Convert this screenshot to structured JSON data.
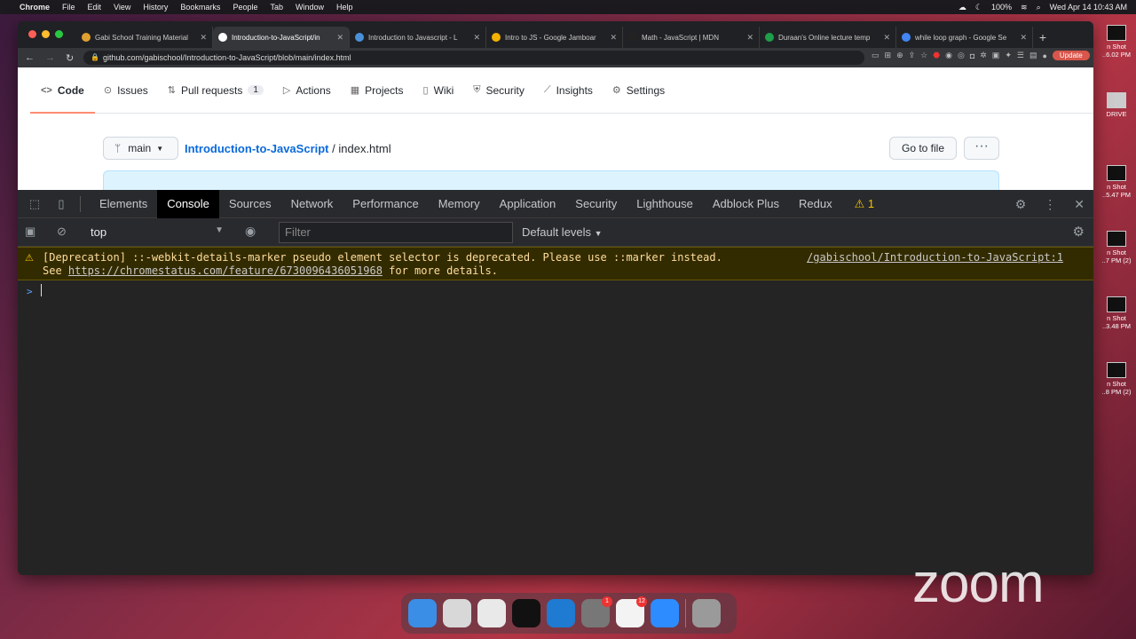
{
  "menubar": {
    "items": [
      "Chrome",
      "File",
      "Edit",
      "View",
      "History",
      "Bookmarks",
      "People",
      "Tab",
      "Window",
      "Help"
    ],
    "battery": "100%",
    "clock": "Wed Apr 14  10:43 AM"
  },
  "desktop": {
    "items": [
      {
        "label": "n Shot",
        "sub": "..6.02 PM"
      },
      {
        "label": "DRIVE",
        "sub": ""
      },
      {
        "label": "n Shot",
        "sub": "..5.47 PM"
      },
      {
        "label": "n Shot",
        "sub": "..7 PM (2)"
      },
      {
        "label": "n Shot",
        "sub": "..3.48 PM"
      },
      {
        "label": "n Shot",
        "sub": "..8 PM (2)"
      }
    ]
  },
  "browser": {
    "tabs": [
      {
        "title": "Gabi School Training Material",
        "icon_color": "#e0a030"
      },
      {
        "title": "Introduction-to-JavaScript/in",
        "icon_color": "#ffffff"
      },
      {
        "title": "Introduction to Javascript - L",
        "icon_color": "#4a90d9"
      },
      {
        "title": "Intro to JS - Google Jamboar",
        "icon_color": "#f2b200"
      },
      {
        "title": "Math - JavaScript | MDN",
        "icon_color": "#222222"
      },
      {
        "title": "Duraan's Online lecture temp",
        "icon_color": "#1e9e4a"
      },
      {
        "title": "while loop graph - Google Se",
        "icon_color": "#4285f4"
      }
    ],
    "url": "github.com/gabischool/Introduction-to-JavaScript/blob/main/index.html",
    "update_label": "Update"
  },
  "github": {
    "nav": [
      {
        "label": "Code",
        "icon": "<>",
        "count": ""
      },
      {
        "label": "Issues",
        "icon": "⊙",
        "count": ""
      },
      {
        "label": "Pull requests",
        "icon": "⇅",
        "count": "1"
      },
      {
        "label": "Actions",
        "icon": "▷",
        "count": ""
      },
      {
        "label": "Projects",
        "icon": "▦",
        "count": ""
      },
      {
        "label": "Wiki",
        "icon": "▯",
        "count": ""
      },
      {
        "label": "Security",
        "icon": "⛨",
        "count": ""
      },
      {
        "label": "Insights",
        "icon": "⟋",
        "count": ""
      },
      {
        "label": "Settings",
        "icon": "⚙",
        "count": ""
      }
    ],
    "branch": "main",
    "repo": "Introduction-to-JavaScript",
    "sep": " / ",
    "file": "index.html",
    "goto_file": "Go to file",
    "more": "···"
  },
  "devtools": {
    "tabs": [
      "Elements",
      "Console",
      "Sources",
      "Network",
      "Performance",
      "Memory",
      "Application",
      "Security",
      "Lighthouse",
      "Adblock Plus",
      "Redux"
    ],
    "active_tab": "Console",
    "warning_count": "1",
    "context": "top",
    "filter_placeholder": "Filter",
    "levels": "Default levels"
  },
  "console": {
    "message_line1": "[Deprecation] ::-webkit-details-marker pseudo element selector is deprecated. Please use ::marker instead.",
    "message_see": "See ",
    "message_link": "https://chromestatus.com/feature/6730096436051968",
    "message_tail": " for more details.",
    "source": "/gabischool/Introduction-to-JavaScript:1",
    "prompt": ">"
  },
  "watermark": "zoom",
  "dock": {
    "apps": [
      {
        "name": "finder",
        "color": "#3a8ee6",
        "badge": ""
      },
      {
        "name": "launchpad",
        "color": "#d8d8d8",
        "badge": ""
      },
      {
        "name": "chrome",
        "color": "#e9e9e9",
        "badge": ""
      },
      {
        "name": "terminal",
        "color": "#111111",
        "badge": ""
      },
      {
        "name": "vscode",
        "color": "#1f7ad1",
        "badge": ""
      },
      {
        "name": "system-preferences",
        "color": "#777777",
        "badge": "1"
      },
      {
        "name": "slack",
        "color": "#f3f3f3",
        "badge": "12"
      },
      {
        "name": "zoom",
        "color": "#2d8cff",
        "badge": ""
      },
      {
        "name": "trash",
        "color": "#9a9a9a",
        "badge": ""
      }
    ]
  }
}
